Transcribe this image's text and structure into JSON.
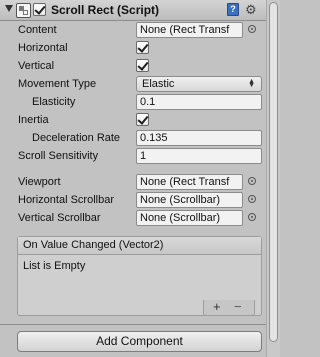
{
  "component": {
    "title": "Scroll Rect (Script)",
    "enabled": true,
    "help_icon": "?"
  },
  "properties": {
    "content": {
      "label": "Content",
      "value": "None (Rect Transf"
    },
    "horizontal": {
      "label": "Horizontal",
      "checked": true
    },
    "vertical": {
      "label": "Vertical",
      "checked": true
    },
    "movement_type": {
      "label": "Movement Type",
      "value": "Elastic",
      "arrow": "▲\n▼"
    },
    "elasticity": {
      "label": "Elasticity",
      "value": "0.1"
    },
    "inertia": {
      "label": "Inertia",
      "checked": true
    },
    "deceleration_rate": {
      "label": "Deceleration Rate",
      "value": "0.135"
    },
    "scroll_sensitivity": {
      "label": "Scroll Sensitivity",
      "value": "1"
    },
    "viewport": {
      "label": "Viewport",
      "value": "None (Rect Transf"
    },
    "horizontal_scrollbar": {
      "label": "Horizontal Scrollbar",
      "value": "None (Scrollbar)"
    },
    "vertical_scrollbar": {
      "label": "Vertical Scrollbar",
      "value": "None (Scrollbar)"
    }
  },
  "event": {
    "title": "On Value Changed (Vector2)",
    "empty_text": "List is Empty",
    "add_symbol": "+",
    "remove_symbol": "−"
  },
  "footer": {
    "add_component_label": "Add Component"
  },
  "icons": {
    "foldout": "foldout-arrow-icon",
    "component": "scroll-rect-component-icon",
    "help": "help-book-icon",
    "settings": "gear-icon",
    "object_picker": "object-picker-icon"
  },
  "colors": {
    "panel_bg": "#c2c2c2",
    "field_bg": "#f2f2f2",
    "help_icon": "#3d6fbf"
  }
}
